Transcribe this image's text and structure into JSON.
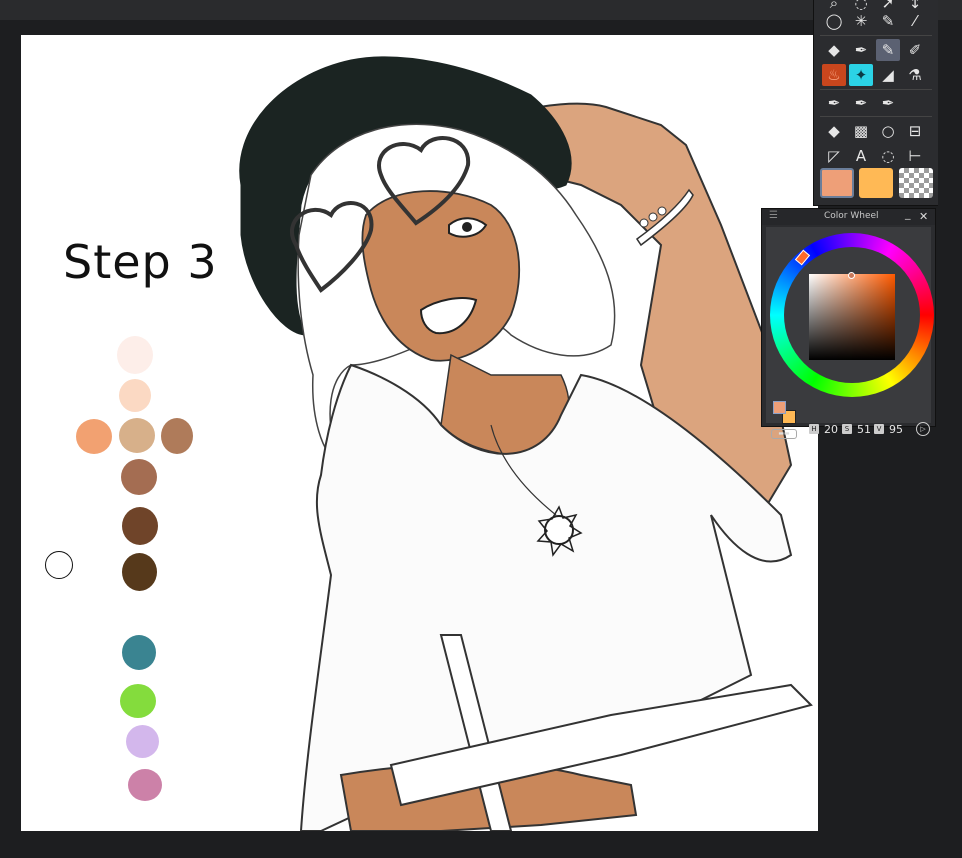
{
  "canvas": {
    "step_label": "Step 3",
    "swatches": [
      {
        "name": "swatch-pale-pink",
        "color": "#fdeee9"
      },
      {
        "name": "swatch-light-peach",
        "color": "#fbd9c3"
      },
      {
        "name": "swatch-orange-peach",
        "color": "#f2a171"
      },
      {
        "name": "swatch-tan",
        "color": "#d7b08a"
      },
      {
        "name": "swatch-brown-right",
        "color": "#af7b5a"
      },
      {
        "name": "swatch-mid-brown",
        "color": "#a46d52"
      },
      {
        "name": "swatch-dark-brown",
        "color": "#6f4429"
      },
      {
        "name": "swatch-darkest-brown",
        "color": "#56391b"
      },
      {
        "name": "swatch-teal",
        "color": "#3a8491"
      },
      {
        "name": "swatch-green",
        "color": "#84dc3d"
      },
      {
        "name": "swatch-lavender",
        "color": "#d3b7ec"
      },
      {
        "name": "swatch-mauve-pink",
        "color": "#cc81a8"
      }
    ]
  },
  "tool_palette": {
    "icons": [
      "zoom-icon",
      "lasso-marquee-icon",
      "object-select-icon",
      "move-icon",
      "lasso-icon",
      "magic-wand-icon",
      "auto-select-icon",
      "eyedropper-icon",
      "eraser-icon",
      "pen-icon",
      "pencil-icon",
      "marker-icon",
      "fill-icon",
      "sparkle-brush-icon",
      "airbrush-icon",
      "blend-icon",
      "g-pen-icon",
      "turnip-pen-icon",
      "mapping-pen-icon",
      "fill-bucket-icon",
      "gradient-icon",
      "shape-icon",
      "frame-icon",
      "ruler-icon",
      "text-icon",
      "balloon-icon",
      "correct-line-icon"
    ],
    "main_color": "#ee9f78",
    "sub_color": "#ffb955"
  },
  "color_wheel": {
    "title": "Color Wheel",
    "h_label": "H",
    "h_value": "20",
    "s_label": "S",
    "s_value": "51",
    "v_label": "V",
    "v_value": "95"
  }
}
